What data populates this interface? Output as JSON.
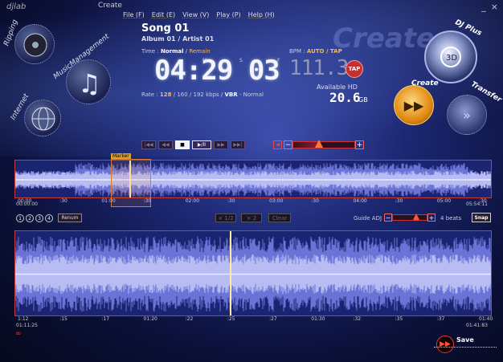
{
  "app": {
    "logo": "djlab",
    "mode": "Create"
  },
  "menu": [
    "File (F)",
    "Edit (E)",
    "View (V)",
    "Play (P)",
    "Help (H)"
  ],
  "window_controls": {
    "minimize": "_",
    "close": "×"
  },
  "nav": {
    "ripping": "Ripping",
    "music_management": "MusicManagement",
    "internet": "Internet"
  },
  "right_nav": {
    "dj_plus": "DJ Plus",
    "create": "Create",
    "transfer": "Transfer"
  },
  "song": {
    "title": "Song 01",
    "subtitle": "Album 01 / Artist 01",
    "time_label": "Time :",
    "time_mode": "Normal",
    "time_mode_alt": "Remain",
    "time_display": "04:29 03",
    "unit_m": "M",
    "unit_s": "S",
    "unit_f": "F",
    "rate_label": "Rate :",
    "rate_hl": "128",
    "rate_rest": "/ 160 / 192 kbps /",
    "rate_vbr": "VBR",
    "rate_mode": "- Normal"
  },
  "bpm": {
    "label": "BPM :",
    "mode": "AUTO / TAP",
    "value": "111.3",
    "tap": "TAP"
  },
  "storage": {
    "label": "Available HD",
    "value": "20.6",
    "unit": "GB"
  },
  "watermark": "Create",
  "transport": {
    "buttons": [
      "|◀◀",
      "◀◀",
      "■",
      "▶/II",
      "▶▶",
      "▶▶|"
    ],
    "active_index": 2,
    "volume": 0.42
  },
  "overview": {
    "marker_label": "Marker",
    "ticks": [
      "00:00",
      ":30",
      "01:00",
      ":30",
      "02:00",
      ":30",
      "03:00",
      ":30",
      "04:00",
      ":30",
      "05:00",
      ":30"
    ],
    "time_left": "00:00:00",
    "time_right": "05:54:11"
  },
  "controls": {
    "pages": [
      "1",
      "2",
      "3",
      "4"
    ],
    "renum": "Renum",
    "x_half": "× 1/2",
    "x_two": "× 2",
    "clear": "Clear",
    "guide_label": "Guide ADJ",
    "guide_level": 0.7,
    "beats_value": "4",
    "beats_label": "beats",
    "snap": "Snap"
  },
  "detail": {
    "ticks": [
      "1:12",
      ":15",
      ":17",
      "01:20",
      ":22",
      ":25",
      ":27",
      "01:30",
      ":32",
      ":35",
      ":37",
      "01:40"
    ],
    "time_left": "01:11:25",
    "time_right": "01:41:83"
  },
  "save": "Save",
  "colors": {
    "accent": "#ff7733",
    "border": "#c93a3a",
    "wave": "#5a63c9",
    "bg": "#1b2470"
  }
}
